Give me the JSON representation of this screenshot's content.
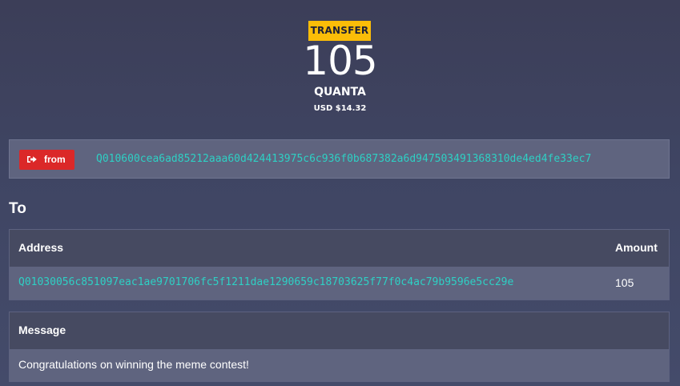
{
  "transaction": {
    "type_label": "TRANSFER",
    "amount": "105",
    "unit": "QUANTA",
    "fiat_value": "USD $14.32"
  },
  "from": {
    "button_label": "from",
    "button_icon": "sign-out-icon",
    "address": "Q010600cea6ad85212aaa60d424413975c6c936f0b687382a6d947503491368310de4ed4fe33ec7"
  },
  "to": {
    "heading": "To",
    "columns": [
      "Address",
      "Amount"
    ],
    "rows": [
      {
        "address": "Q01030056c851097eac1ae9701706fc5f1211dae1290659c18703625f77f0c4ac79b9596e5cc29e",
        "amount": "105"
      }
    ]
  },
  "message": {
    "title": "Message",
    "text": "Congratulations on winning the meme contest!"
  },
  "colors": {
    "badge_bg": "#fbbd08",
    "from_button_bg": "#db2828",
    "address_link": "#2ed0c4",
    "panel_header": "#464a61",
    "panel_row": "#5f647f"
  }
}
